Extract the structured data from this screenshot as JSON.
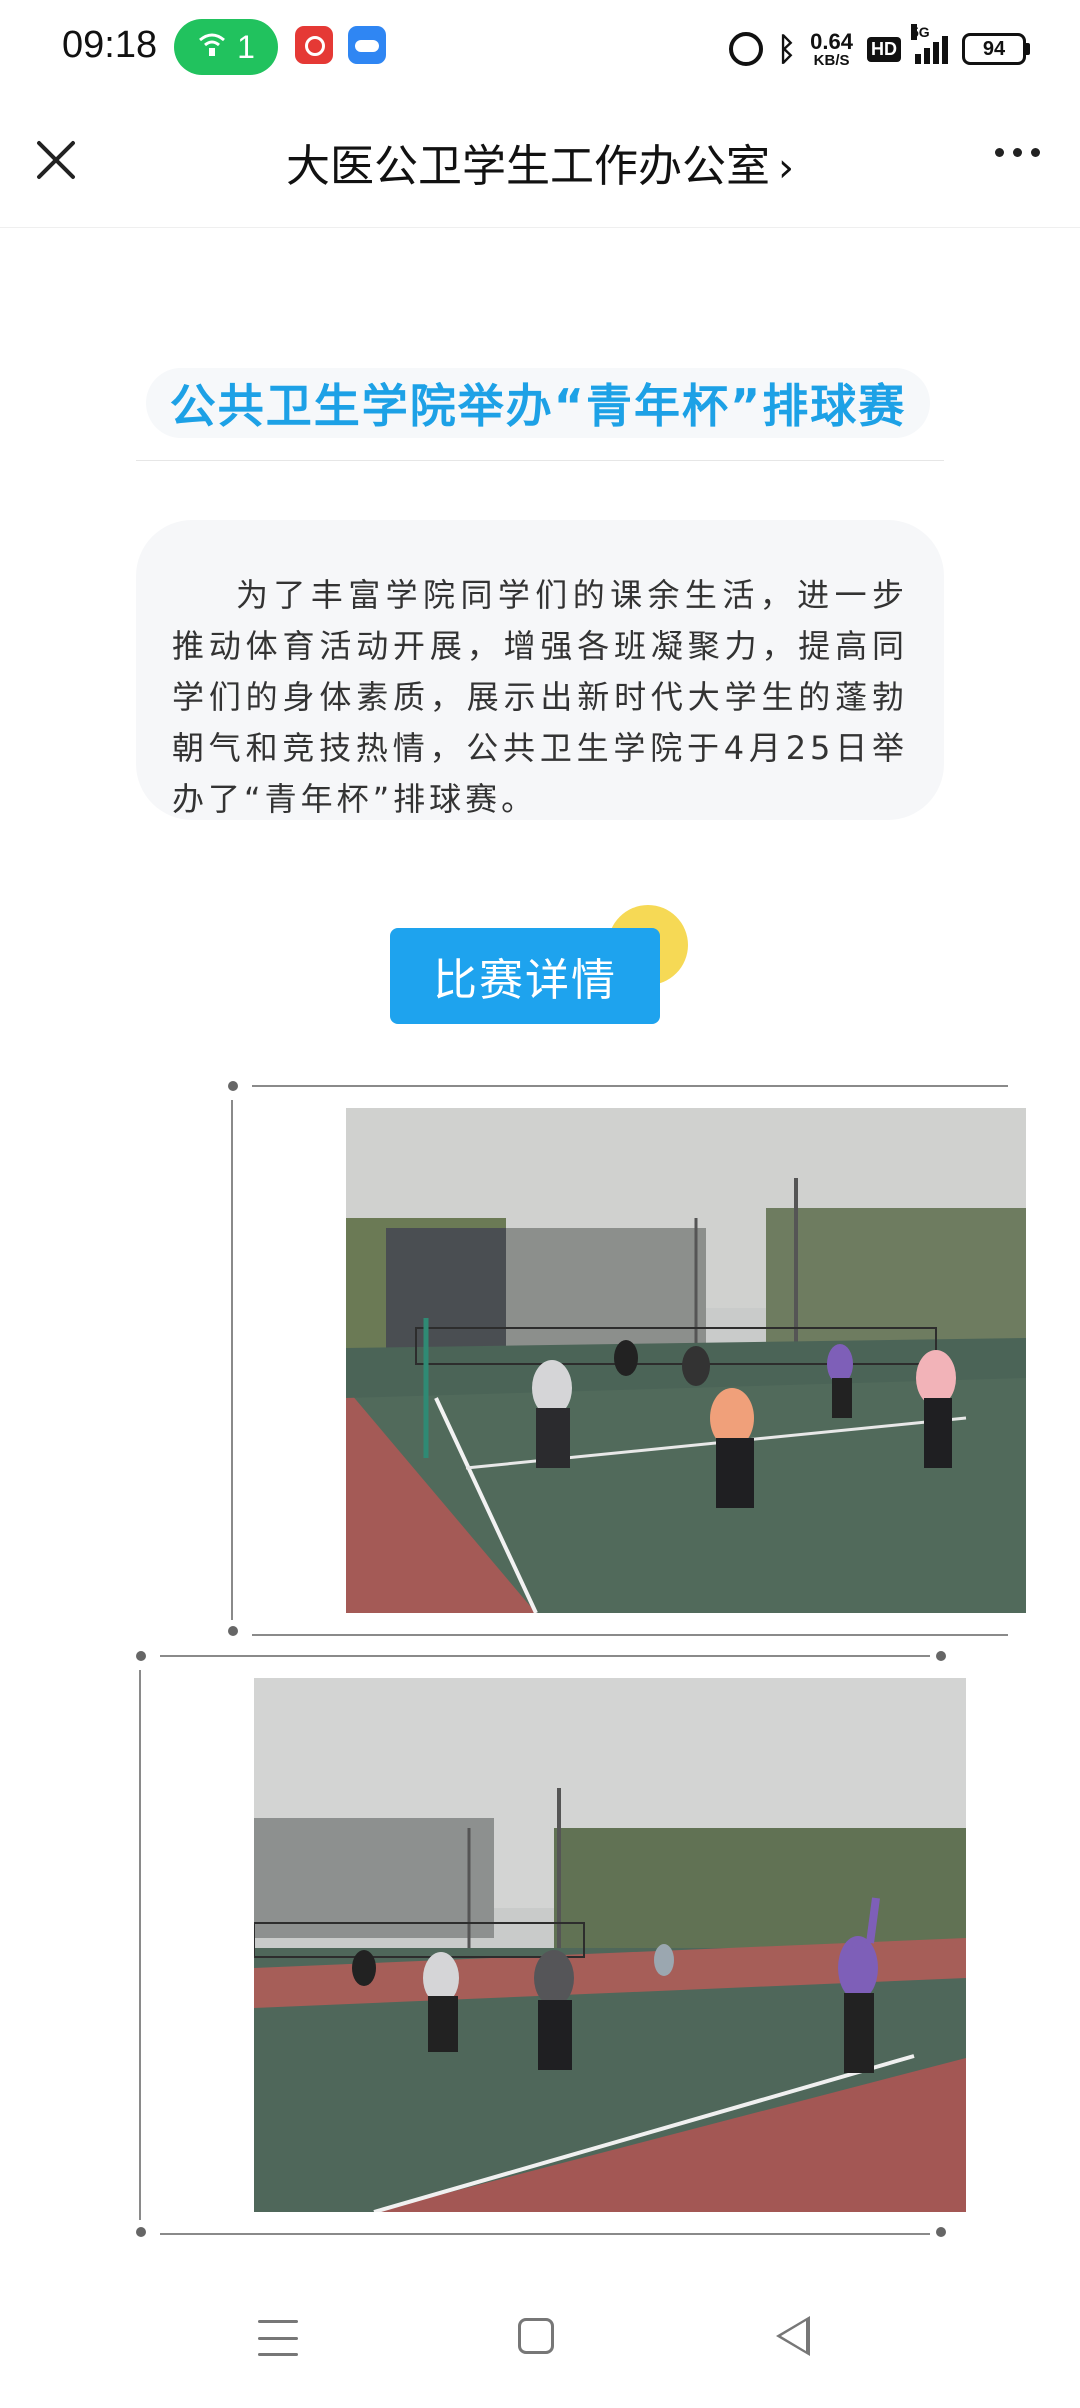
{
  "status_bar": {
    "time": "09:18",
    "hotspot_count": "1",
    "network_speed": "0.64",
    "speed_unit": "KB/S",
    "hd": "HD",
    "network_type": "5G",
    "battery": "94"
  },
  "app_bar": {
    "account_name": "大医公卫学生工作办公室",
    "chevron": "›"
  },
  "article": {
    "headline": "公共卫生学院举办“青年杯”排球赛",
    "intro": "为了丰富学院同学们的课余生活，进一步推动体育活动开展，增强各班凝聚力，提高同学们的身体素质，展示出新时代大学生的蓬勃朝气和竞技热情，公共卫生学院于4月25日举办了“青年杯”排球赛。",
    "details_button": "比赛详情"
  },
  "photos": [
    {
      "subject": "volleyball-match-photo-1"
    },
    {
      "subject": "volleyball-match-photo-2"
    }
  ],
  "colors": {
    "accent": "#1ea3ee",
    "headline": "#1da1e6",
    "hotspot": "#21c25e"
  }
}
